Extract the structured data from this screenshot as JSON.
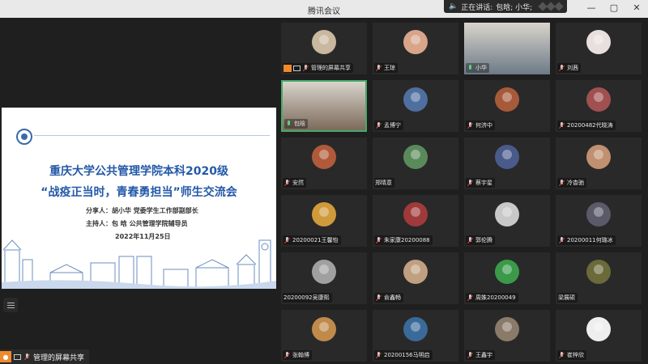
{
  "window": {
    "title": "腾讯会议",
    "speaking_prefix": "正在讲话:",
    "speaking_names": "包晗; 小华;",
    "controls": [
      "—",
      "▢",
      "✕"
    ]
  },
  "slide": {
    "title_line1": "重庆大学公共管理学院本科2020级",
    "title_line2": "“战疫正当时，青春勇担当”师生交流会",
    "sharer": "分享人：胡小华  党委学生工作部副部长",
    "host": "主持人：包  晗  公共管理学院辅导员",
    "date": "2022年11月25日"
  },
  "bottom_label": "管理的屏幕共享",
  "participants": [
    {
      "name": "管理的屏幕共享",
      "mic": "off",
      "share": true,
      "avatar_color": "#c9b79f"
    },
    {
      "name": "王琼",
      "mic": "off",
      "avatar_color": "#d8a58a"
    },
    {
      "name": "小华",
      "mic": "on",
      "video": true,
      "avatar_color": "#6d7a86"
    },
    {
      "name": "刘茜",
      "mic": "off",
      "avatar_color": "#e8e0de"
    },
    {
      "name": "包晗",
      "mic": "on",
      "active": true,
      "video": true,
      "avatar_color": "#7c6a5a"
    },
    {
      "name": "孟博宁",
      "mic": "off",
      "avatar_color": "#4f6f9f"
    },
    {
      "name": "何济中",
      "mic": "off",
      "avatar_color": "#a65a3a"
    },
    {
      "name": "20200482代晓涛",
      "mic": "off",
      "avatar_color": "#a05050"
    },
    {
      "name": "安然",
      "mic": "off",
      "avatar_color": "#b05a3a"
    },
    {
      "name": "郑晴意",
      "mic": "none",
      "avatar_color": "#5a8a5a"
    },
    {
      "name": "蔡宇星",
      "mic": "off",
      "avatar_color": "#4a5a8a"
    },
    {
      "name": "冷杳驰",
      "mic": "off",
      "avatar_color": "#c09070"
    },
    {
      "name": "20200021王馨怡",
      "mic": "off",
      "avatar_color": "#d09a3a"
    },
    {
      "name": "朱家康20200088",
      "mic": "off",
      "avatar_color": "#a03a3a"
    },
    {
      "name": "郭伦腾",
      "mic": "off",
      "avatar_color": "#c8c8c8"
    },
    {
      "name": "20200011何璐冰",
      "mic": "off",
      "avatar_color": "#5a5a6a"
    },
    {
      "name": "20200092吴康熙",
      "mic": "none",
      "avatar_color": "#a0a0a0"
    },
    {
      "name": "俞鑫畅",
      "mic": "off",
      "avatar_color": "#c0a080"
    },
    {
      "name": "周姝20200049",
      "mic": "off",
      "avatar_color": "#3a9a4a"
    },
    {
      "name": "梁展硕",
      "mic": "none",
      "avatar_color": "#6a6a3a"
    },
    {
      "name": "张翰博",
      "mic": "off",
      "avatar_color": "#c08a4a"
    },
    {
      "name": "20200156马明启",
      "mic": "off",
      "avatar_color": "#3a6a9a"
    },
    {
      "name": "王鑫宇",
      "mic": "off",
      "avatar_color": "#8a7a6a"
    },
    {
      "name": "崔梓欣",
      "mic": "off",
      "avatar_color": "#eeeeee"
    }
  ]
}
